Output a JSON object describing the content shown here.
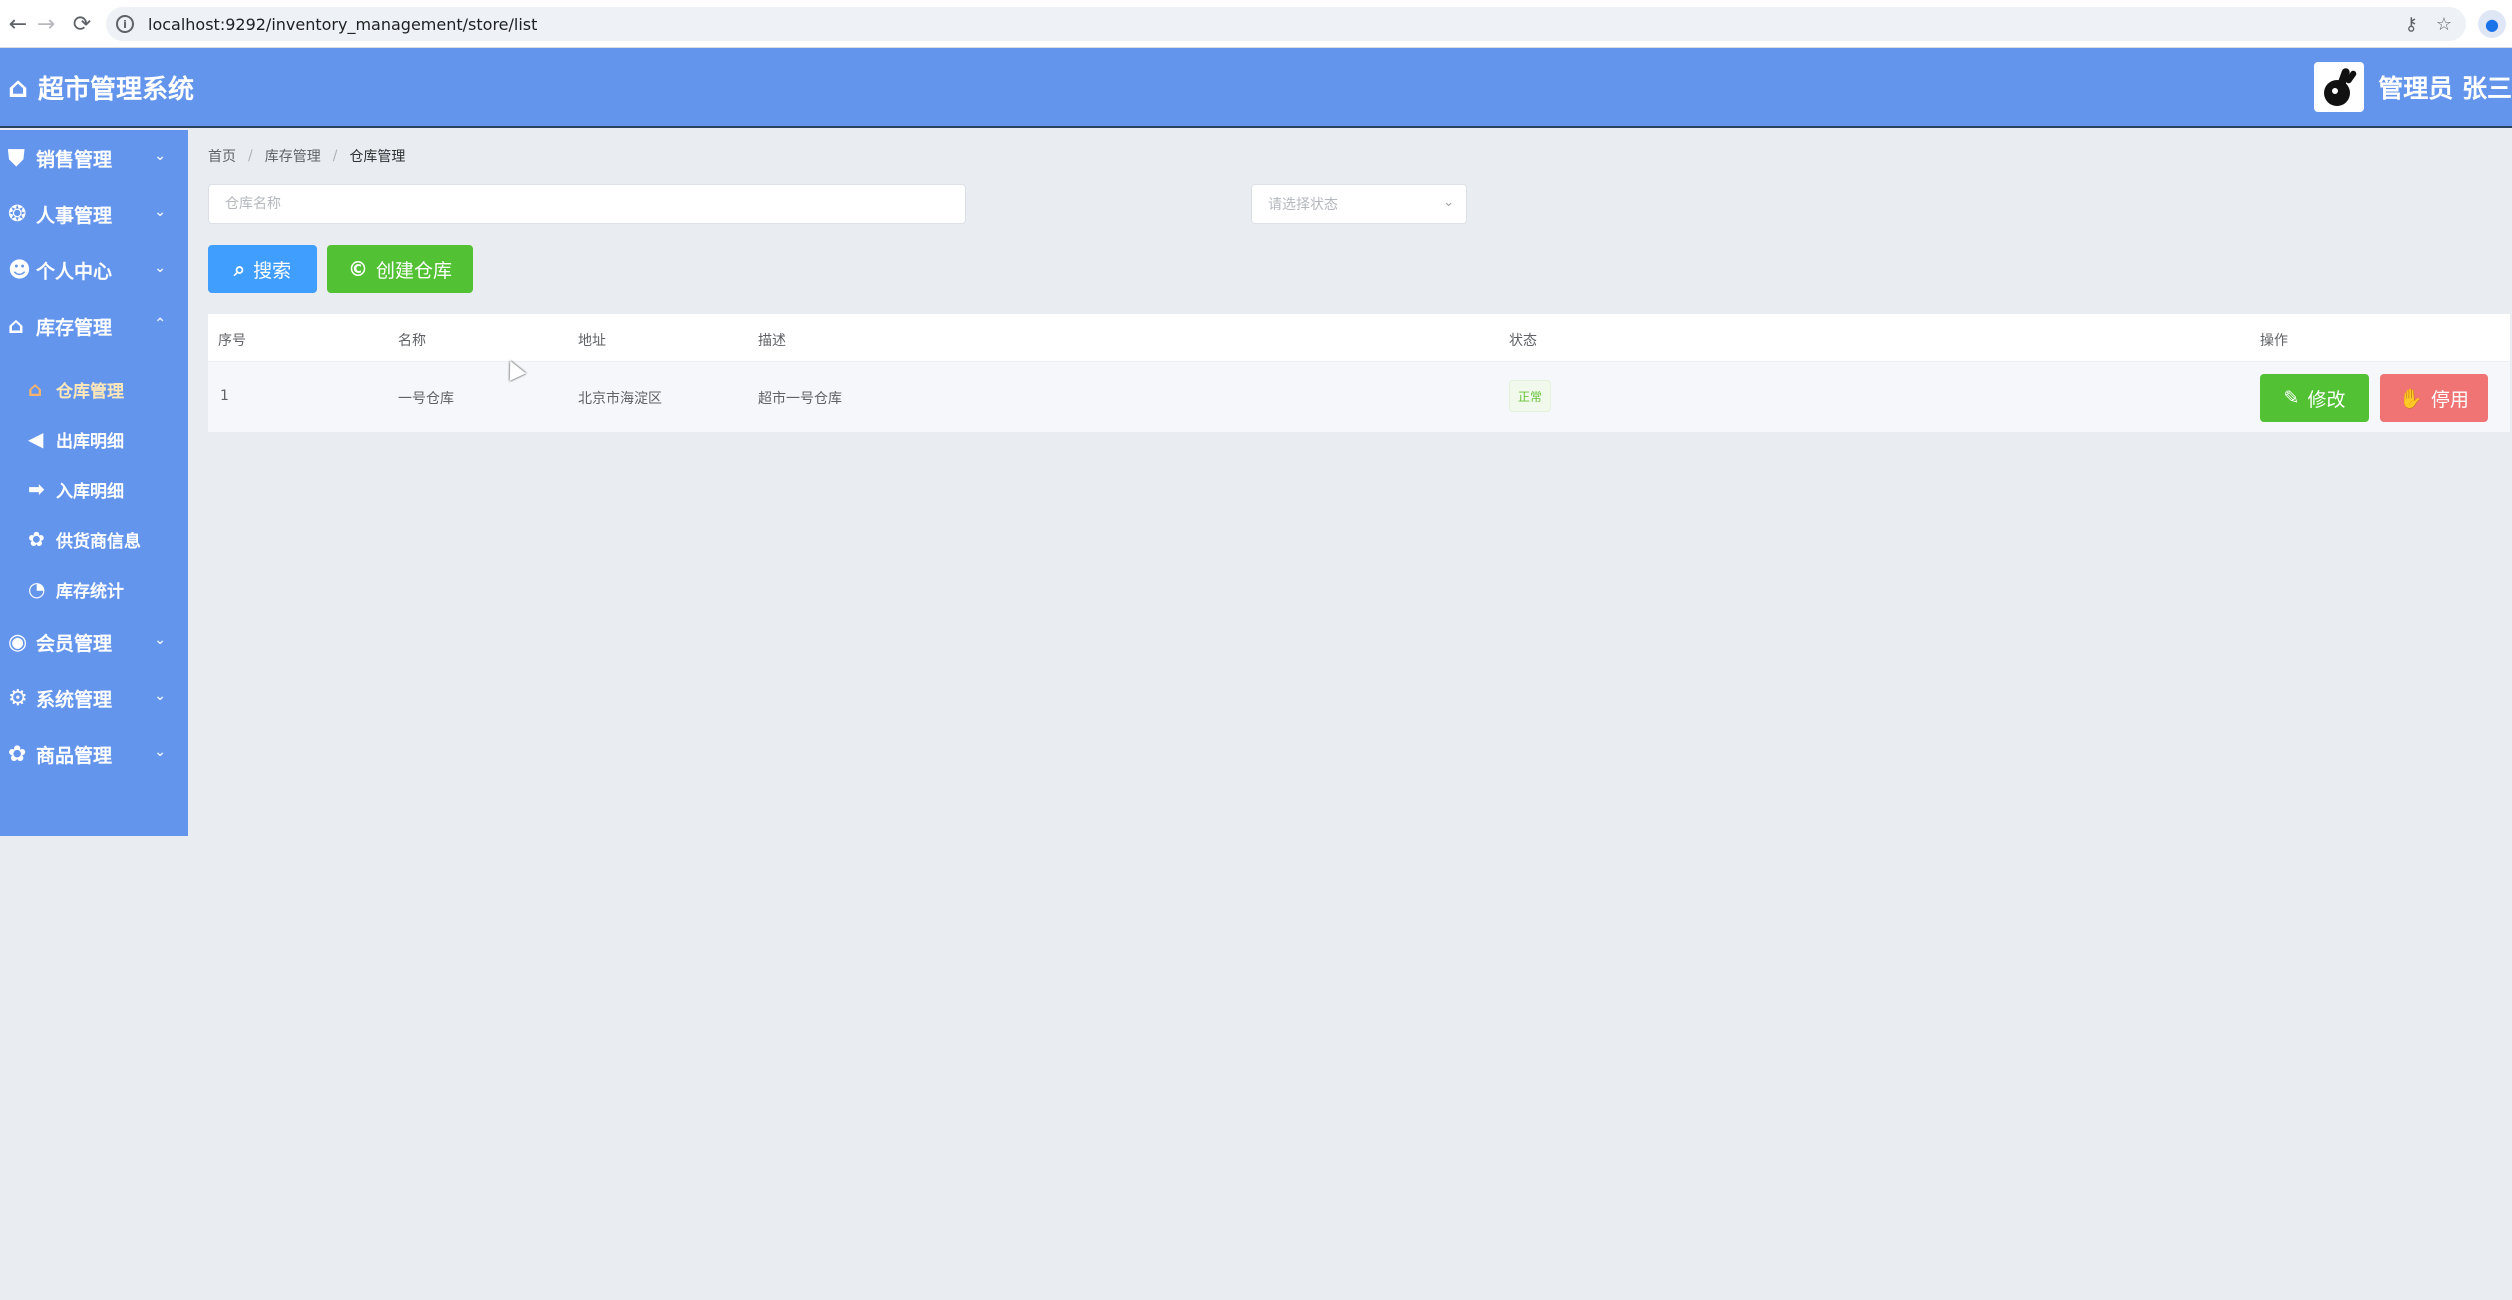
{
  "browser": {
    "back_icon": "←",
    "forward_icon": "→",
    "reload_icon": "⟳",
    "url": "localhost:9292/inventory_management/store/list"
  },
  "header": {
    "app_title": "超市管理系统",
    "user_name": "管理员 张三",
    "color": "#6495ed"
  },
  "sidebar": {
    "groups_top": [
      {
        "label": "销售管理",
        "icon": "sales-icon"
      },
      {
        "label": "人事管理",
        "icon": "users-icon"
      },
      {
        "label": "个人中心",
        "icon": "user-icon"
      }
    ],
    "expanded_group": {
      "label": "库存管理",
      "icon": "warehouse-icon"
    },
    "sub_items": [
      {
        "label": "仓库管理",
        "icon": "store-icon",
        "active": true
      },
      {
        "label": "出库明细",
        "icon": "arrow-left-icon"
      },
      {
        "label": "入库明细",
        "icon": "arrow-right-icon"
      },
      {
        "label": "供货商信息",
        "icon": "supplier-icon"
      },
      {
        "label": "库存统计",
        "icon": "stats-icon"
      }
    ],
    "groups_bottom": [
      {
        "label": "会员管理",
        "icon": "member-icon"
      },
      {
        "label": "系统管理",
        "icon": "gear-icon"
      },
      {
        "label": "商品管理",
        "icon": "goods-icon"
      }
    ]
  },
  "breadcrumb": [
    "首页",
    "库存管理",
    "仓库管理"
  ],
  "filters": {
    "name_placeholder": "仓库名称",
    "status_placeholder": "请选择状态"
  },
  "actions": {
    "search_label": "搜索",
    "create_label": "创建仓库"
  },
  "table": {
    "headers": [
      "序号",
      "名称",
      "地址",
      "描述",
      "状态",
      "操作"
    ],
    "rows": [
      {
        "index": "1",
        "name": "一号仓库",
        "address": "北京市海淀区",
        "description": "超市一号仓库",
        "status": "正常",
        "edit_label": "修改",
        "disable_label": "停用"
      }
    ]
  },
  "colors": {
    "primary": "#409eff",
    "success": "#52c234",
    "danger": "#f07474",
    "sidebar": "#6495ed"
  }
}
